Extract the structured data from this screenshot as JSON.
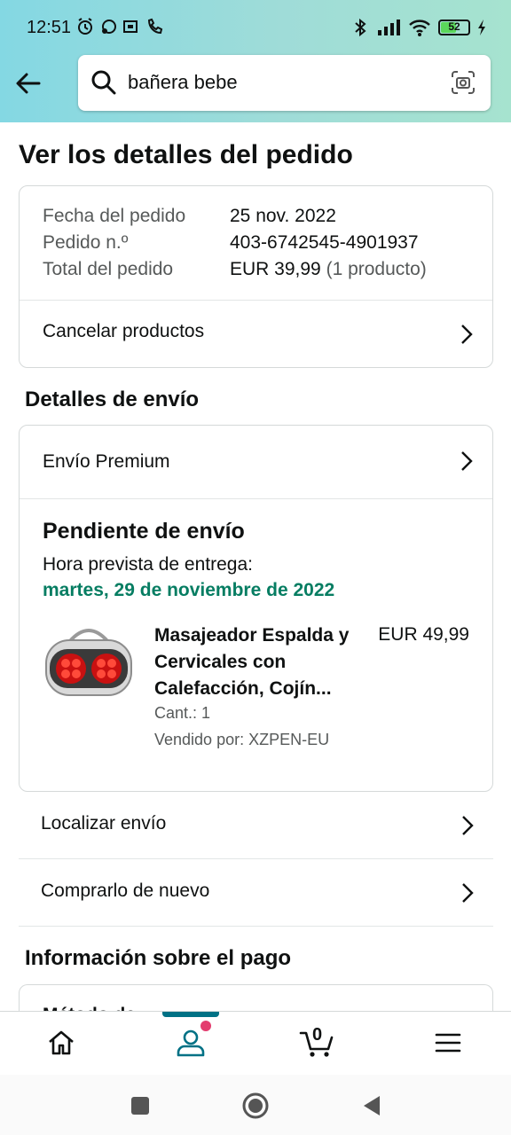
{
  "status_bar": {
    "time": "12:51",
    "battery": "52",
    "icons": [
      "alarm-icon",
      "whatsapp-icon",
      "sim-icon",
      "call-icon",
      "bluetooth-icon",
      "signal-icon",
      "wifi-icon",
      "battery-icon",
      "charging-icon"
    ]
  },
  "header": {
    "back_icon": "arrow-left-icon",
    "search": {
      "query": "bañera bebe",
      "search_icon": "search-icon",
      "camera_icon": "camera-scan-icon"
    }
  },
  "page": {
    "title": "Ver los detalles del pedido"
  },
  "order_summary": {
    "rows": [
      {
        "label": "Fecha del pedido",
        "value": "25 nov. 2022"
      },
      {
        "label": "Pedido n.º",
        "value": "403-6742545-4901937"
      },
      {
        "label": "Total del pedido",
        "value": "EUR 39,99",
        "extra": "(1 producto)"
      }
    ],
    "cancel_label": "Cancelar productos"
  },
  "shipping": {
    "section_title": "Detalles de envío",
    "shipping_type": "Envío Premium",
    "status_title": "Pendiente de envío",
    "eta_label": "Hora prevista de entrega:",
    "eta_date": "martes, 29 de noviembre de 2022",
    "item": {
      "name": "Masajeador Espalda y Cervicales con Calefacción, Cojín...",
      "price": "EUR 49,99",
      "quantity": "Cant.: 1",
      "seller": "Vendido por: XZPEN-EU"
    }
  },
  "actions": {
    "track": "Localizar envío",
    "buy_again": "Comprarlo de nuevo"
  },
  "payment": {
    "section_title": "Información sobre el pago",
    "first_row_partial": "Método de"
  },
  "bottom_nav": {
    "items": [
      "home-icon",
      "account-icon",
      "cart-icon",
      "menu-icon"
    ],
    "cart_count": "0",
    "active": "account-icon",
    "accent_color": "#007185",
    "notification_color": "#e33c6e"
  },
  "colors": {
    "eta_green": "#067d62",
    "header_gradient_start": "#84d8e3",
    "header_gradient_end": "#a6e3cf"
  }
}
